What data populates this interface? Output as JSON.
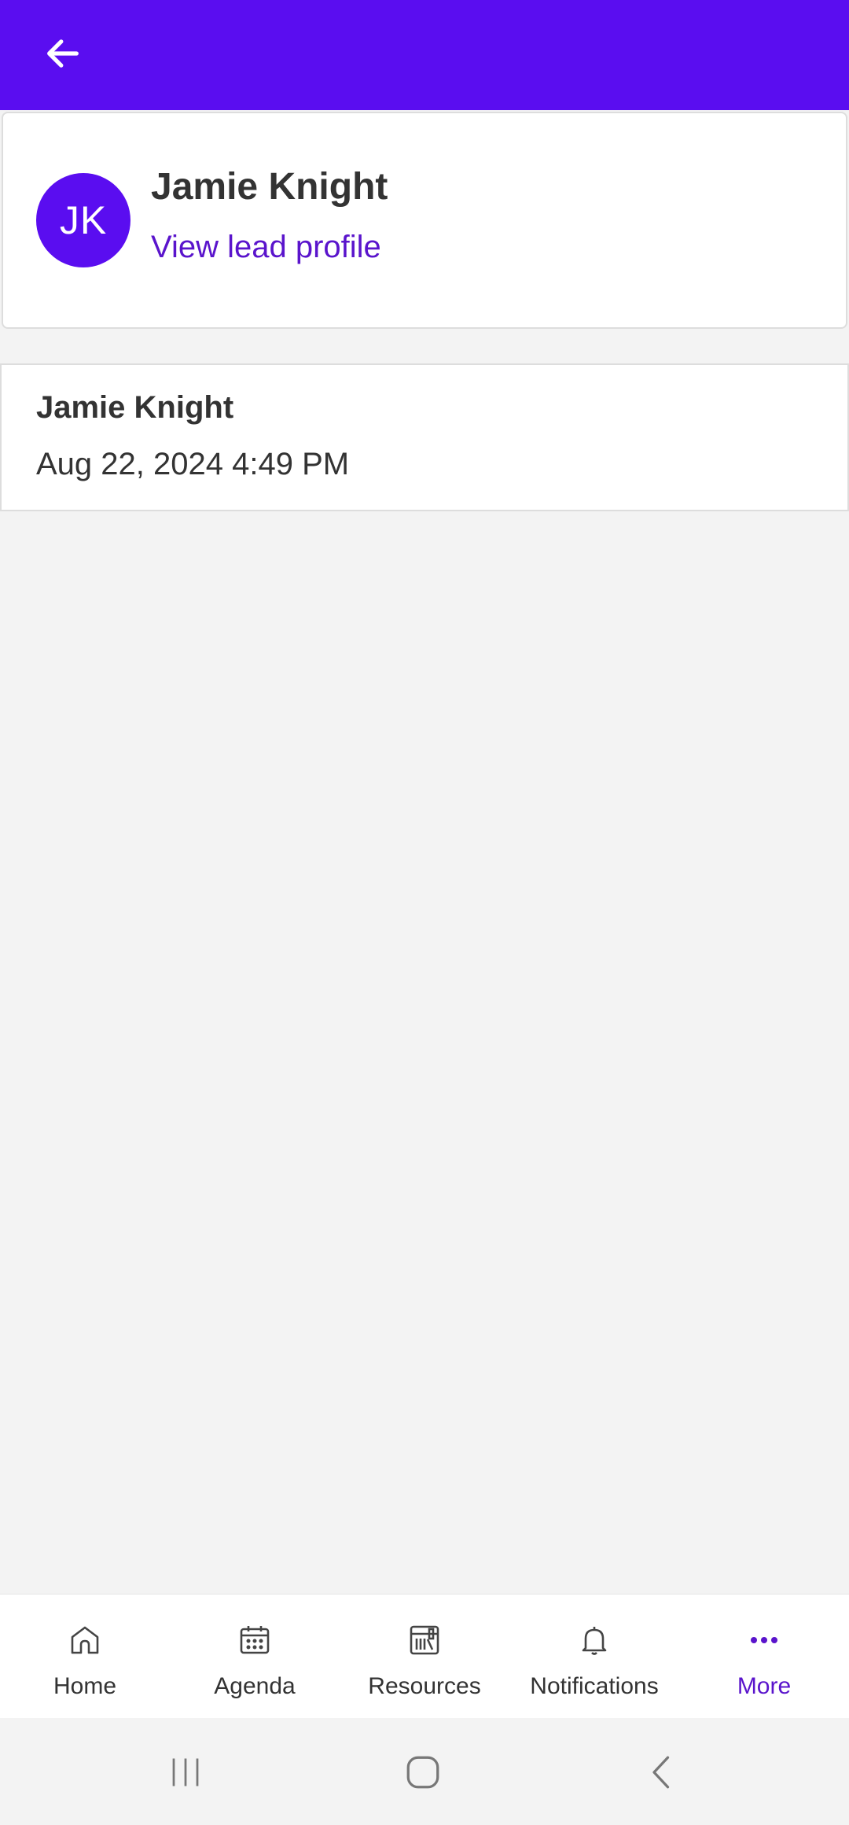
{
  "header": {
    "back_icon": "arrow-left-icon",
    "bg_color": "#5a0df0"
  },
  "lead": {
    "initials": "JK",
    "name": "Jamie Knight",
    "profile_link": "View lead profile",
    "link_color": "#5a14cc"
  },
  "activity": {
    "title": "Jamie Knight",
    "timestamp": "Aug 22, 2024 4:49 PM"
  },
  "bottom_nav": {
    "items": [
      {
        "label": "Home",
        "icon": "home-icon",
        "active": false
      },
      {
        "label": "Agenda",
        "icon": "calendar-icon",
        "active": false
      },
      {
        "label": "Resources",
        "icon": "library-icon",
        "active": false
      },
      {
        "label": "Notifications",
        "icon": "bell-icon",
        "active": false
      },
      {
        "label": "More",
        "icon": "more-dots-icon",
        "active": true
      }
    ],
    "active_color": "#5a14cc"
  },
  "system_nav": {
    "recents_icon": "recents-icon",
    "home_icon": "system-home-icon",
    "back_icon": "system-back-icon"
  }
}
